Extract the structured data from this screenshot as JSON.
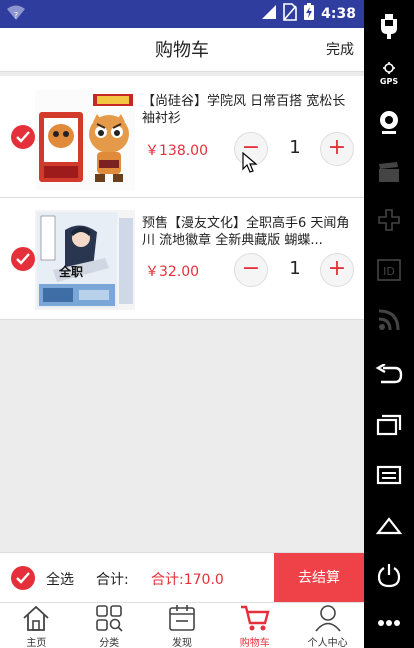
{
  "status_bar": {
    "time": "4:38"
  },
  "header": {
    "title": "购物车",
    "done_label": "完成"
  },
  "cart_items": [
    {
      "title": "【尚硅谷】学院风 日常百搭 宽松长袖衬衫",
      "price": "￥138.00",
      "quantity": "1",
      "checked": true,
      "minus": "−",
      "plus": "+"
    },
    {
      "title": "预售【漫友文化】全职高手6 天闻角川 流地徽章 全新典藏版 蝴蝶...",
      "price": "￥32.00",
      "quantity": "1",
      "checked": true,
      "minus": "−",
      "plus": "+"
    }
  ],
  "footer": {
    "select_all_label": "全选",
    "sum_label": "合计:",
    "sum_value": "合计:170.0",
    "checkout_label": "去结算"
  },
  "bottom_nav": [
    {
      "label": "主页",
      "icon": "home-icon",
      "active": false
    },
    {
      "label": "分类",
      "icon": "category-icon",
      "active": false
    },
    {
      "label": "发现",
      "icon": "discover-icon",
      "active": false
    },
    {
      "label": "购物车",
      "icon": "cart-icon",
      "active": true
    },
    {
      "label": "个人中心",
      "icon": "user-icon",
      "active": false
    }
  ],
  "emulator_panel": {
    "gps_label": "GPS",
    "id_label": "ID"
  },
  "colors": {
    "accent": "#e5303b",
    "checkout": "#ef4248",
    "status_bar": "#2f3e9e"
  }
}
